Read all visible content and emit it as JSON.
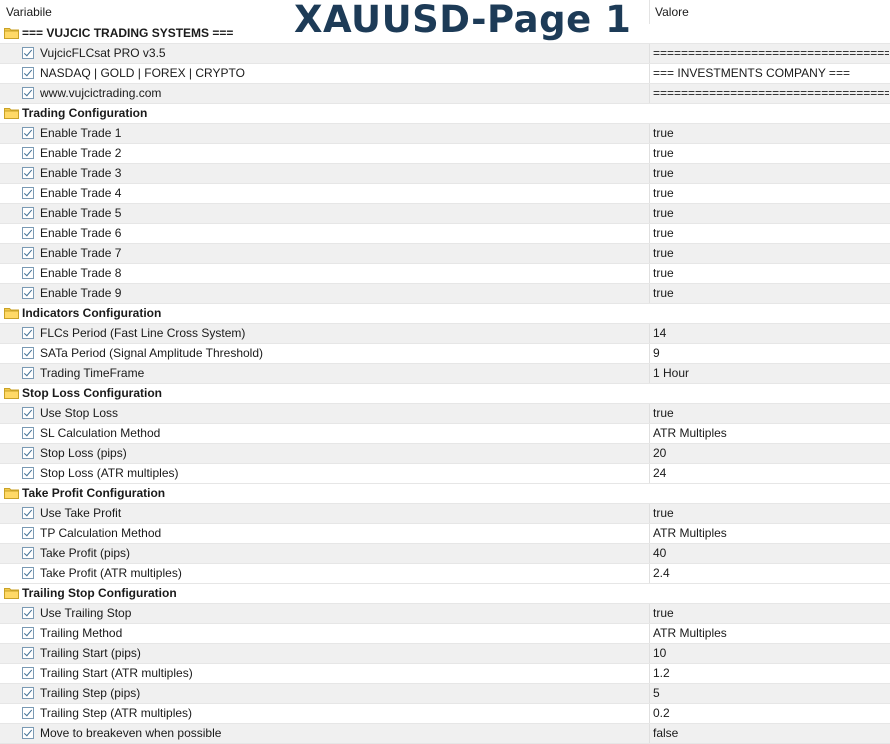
{
  "header": {
    "variable_col": "Variabile",
    "value_col": "Valore"
  },
  "title": "XAUUSD-Page 1",
  "rows": [
    {
      "type": "group",
      "name": "=== VUJCIC TRADING SYSTEMS ==="
    },
    {
      "type": "param",
      "name": "VujcicFLCsat PRO v3.5",
      "value": "====================================="
    },
    {
      "type": "param",
      "name": "NASDAQ | GOLD | FOREX | CRYPTO",
      "value": "=== INVESTMENTS COMPANY ==="
    },
    {
      "type": "param",
      "name": "www.vujcictrading.com",
      "value": "====================================="
    },
    {
      "type": "group",
      "name": "Trading Configuration"
    },
    {
      "type": "param",
      "name": "Enable Trade 1",
      "value": "true"
    },
    {
      "type": "param",
      "name": "Enable Trade 2",
      "value": "true"
    },
    {
      "type": "param",
      "name": "Enable Trade 3",
      "value": "true"
    },
    {
      "type": "param",
      "name": "Enable Trade 4",
      "value": "true"
    },
    {
      "type": "param",
      "name": "Enable Trade 5",
      "value": "true"
    },
    {
      "type": "param",
      "name": "Enable Trade 6",
      "value": "true"
    },
    {
      "type": "param",
      "name": "Enable Trade 7",
      "value": "true"
    },
    {
      "type": "param",
      "name": "Enable Trade 8",
      "value": "true"
    },
    {
      "type": "param",
      "name": "Enable Trade 9",
      "value": "true"
    },
    {
      "type": "group",
      "name": "Indicators Configuration"
    },
    {
      "type": "param",
      "name": "FLCs Period (Fast Line Cross System)",
      "value": "14"
    },
    {
      "type": "param",
      "name": "SATa Period (Signal Amplitude Threshold)",
      "value": "9"
    },
    {
      "type": "param",
      "name": "Trading TimeFrame",
      "value": "1 Hour"
    },
    {
      "type": "group",
      "name": "Stop Loss Configuration"
    },
    {
      "type": "param",
      "name": "Use Stop Loss",
      "value": "true"
    },
    {
      "type": "param",
      "name": "SL Calculation Method",
      "value": "ATR Multiples"
    },
    {
      "type": "param",
      "name": "Stop Loss (pips)",
      "value": "20"
    },
    {
      "type": "param",
      "name": "Stop Loss (ATR multiples)",
      "value": "24"
    },
    {
      "type": "group",
      "name": "Take Profit Configuration"
    },
    {
      "type": "param",
      "name": "Use Take Profit",
      "value": "true"
    },
    {
      "type": "param",
      "name": "TP Calculation Method",
      "value": "ATR Multiples"
    },
    {
      "type": "param",
      "name": "Take Profit (pips)",
      "value": "40"
    },
    {
      "type": "param",
      "name": "Take Profit (ATR multiples)",
      "value": "2.4"
    },
    {
      "type": "group",
      "name": "Trailing Stop Configuration"
    },
    {
      "type": "param",
      "name": "Use Trailing Stop",
      "value": "true"
    },
    {
      "type": "param",
      "name": "Trailing Method",
      "value": "ATR Multiples"
    },
    {
      "type": "param",
      "name": "Trailing Start (pips)",
      "value": "10"
    },
    {
      "type": "param",
      "name": "Trailing Start (ATR multiples)",
      "value": "1.2"
    },
    {
      "type": "param",
      "name": "Trailing Step (pips)",
      "value": "5"
    },
    {
      "type": "param",
      "name": "Trailing Step (ATR multiples)",
      "value": "0.2"
    },
    {
      "type": "param",
      "name": "Move to breakeven when possible",
      "value": "false"
    }
  ]
}
